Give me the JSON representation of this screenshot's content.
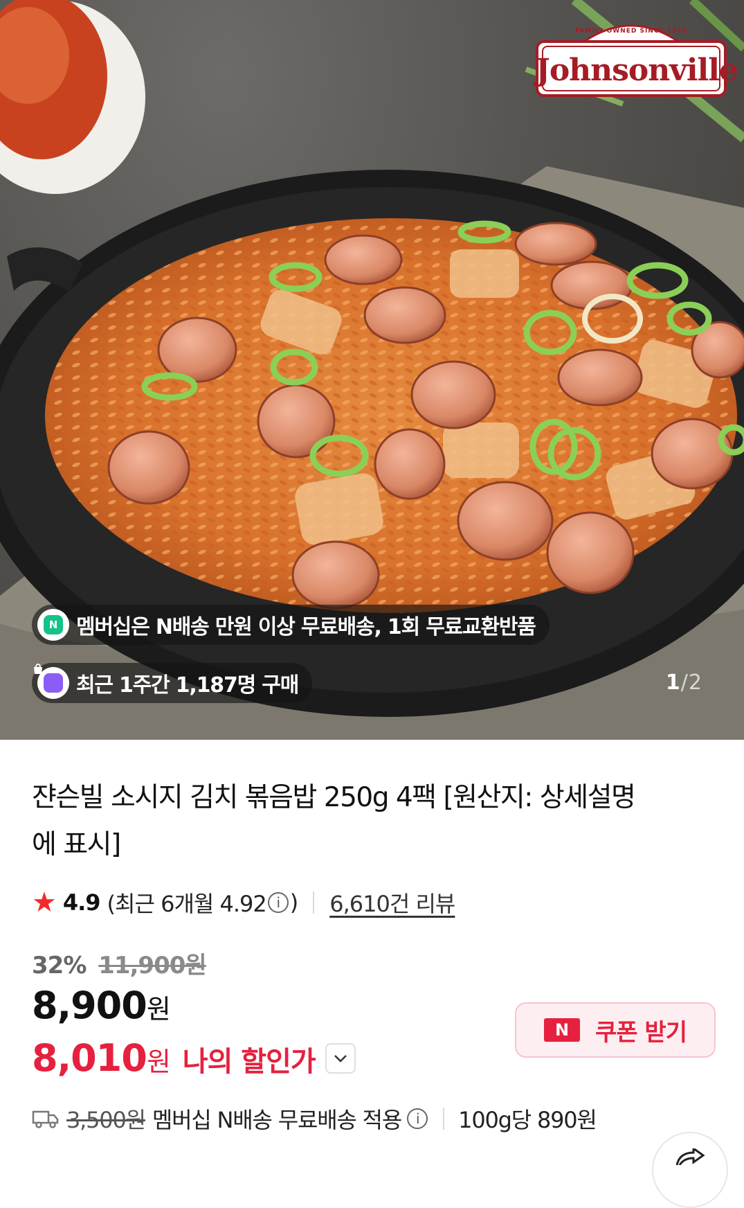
{
  "hero": {
    "brand": {
      "name": "Johnsonville",
      "tagline": "FAMILY OWNED SINCE 1945"
    },
    "benefit_pill": {
      "icon": "n-delivery-icon",
      "text": "멤버십은 N배송 만원 이상 무료배송, 1회 무료교환반품"
    },
    "purchase_pill": {
      "icon": "shopping-bag-icon",
      "text": "최근 1주간 1,187명 구매"
    },
    "counter": {
      "current": "1",
      "separator": "/",
      "total": "2"
    }
  },
  "product": {
    "title": "쟌슨빌 소시지 김치 볶음밥 250g 4팩 [원산지: 상세설명에 표시]",
    "rating": {
      "score": "4.9",
      "recent_prefix": "(최근 6개월 4.92",
      "recent_suffix": ")",
      "info_icon": "i",
      "reviews": "6,610건 리뷰"
    },
    "discount": {
      "rate": "32%",
      "original_price": "11,900원"
    },
    "price": {
      "value": "8,900",
      "unit": "원"
    },
    "my_price": {
      "value": "8,010",
      "unit": "원",
      "label": "나의 할인가"
    },
    "coupon": {
      "logo": "N",
      "label": "쿠폰 받기"
    },
    "shipping": {
      "original_fee": "3,500원",
      "text": "멤버십 N배송 무료배송 적용",
      "info_icon": "i",
      "unit_price": "100g당 890원"
    }
  },
  "colors": {
    "accent": "#e5213f",
    "star": "#f32b2b",
    "coupon_bg": "#fdeff1",
    "brand_red": "#a51c25"
  }
}
